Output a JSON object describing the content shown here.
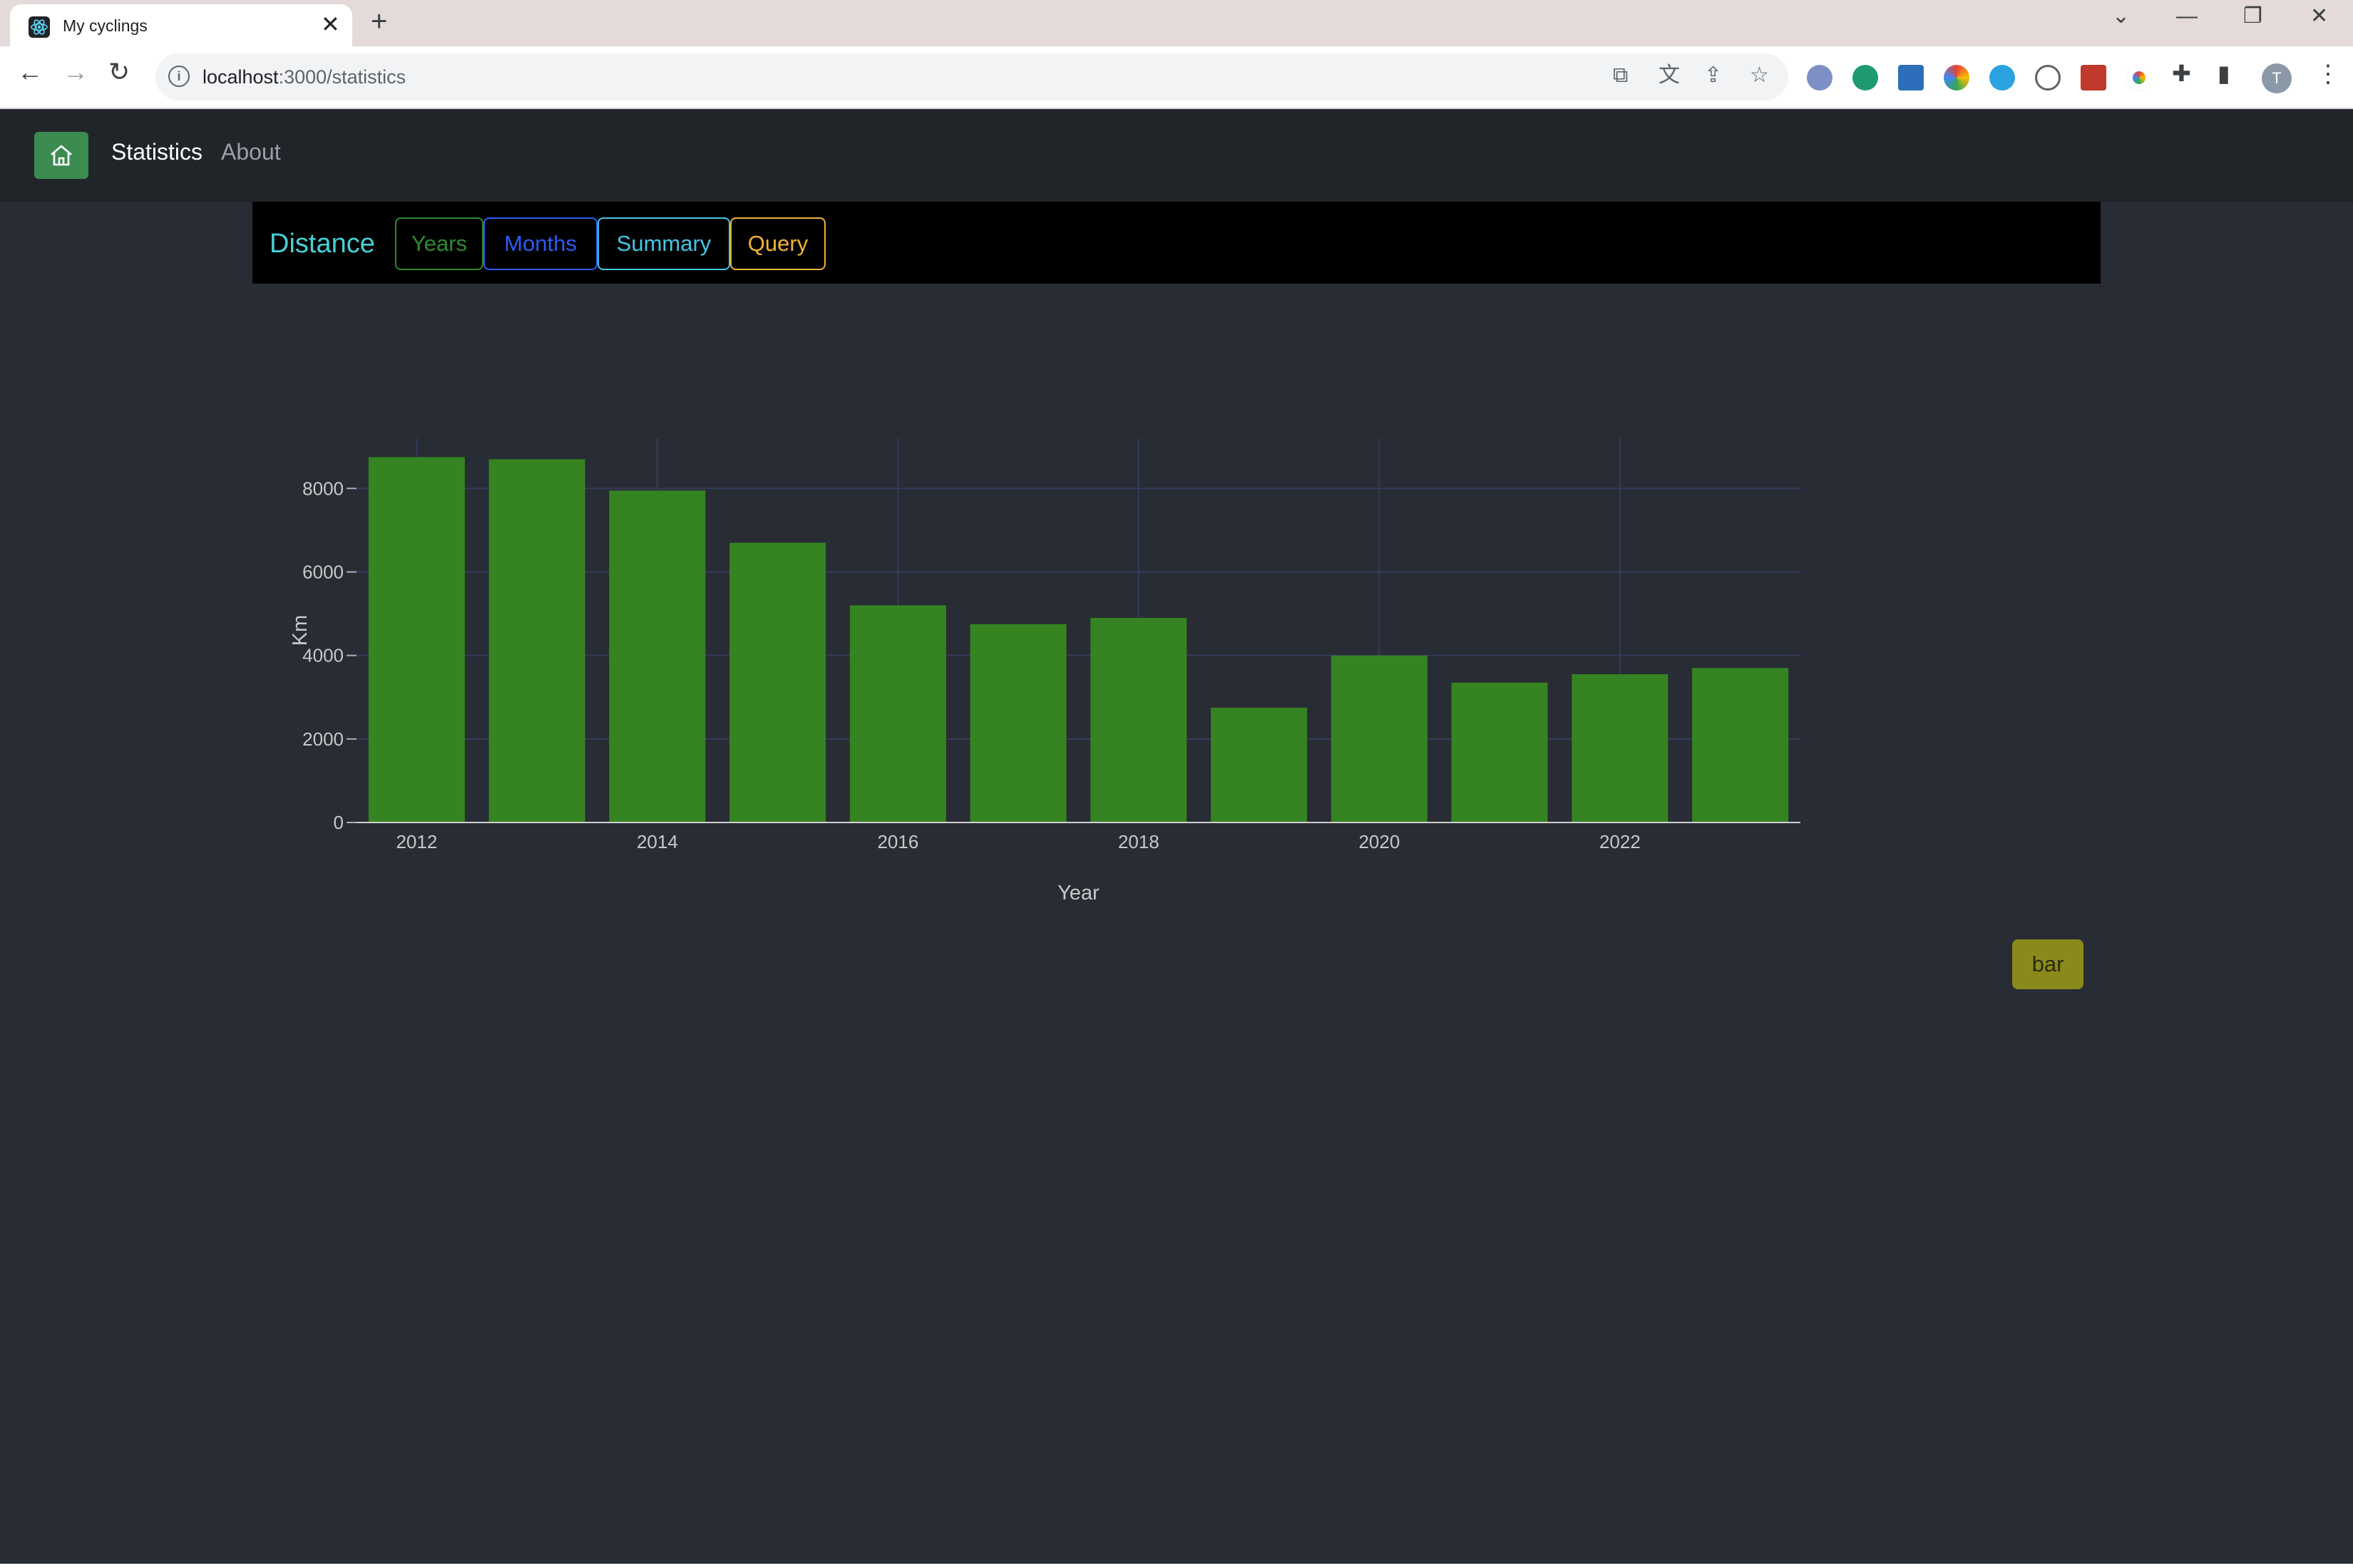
{
  "browser": {
    "tab_title": "My cyclings",
    "url_host": "localhost",
    "url_path": ":3000/statistics",
    "avatar_initial": "T",
    "icons": {
      "favicon": "react-logo-icon",
      "close": "close-icon",
      "new_tab": "plus-icon",
      "back": "arrow-left-icon",
      "forward": "arrow-right-icon",
      "reload": "reload-icon",
      "info": "info-icon",
      "star": "star-icon",
      "menu": "kebab-menu-icon"
    },
    "glyphs": {
      "close": "✕",
      "new_tab": "+",
      "back": "←",
      "forward": "→",
      "reload": "↻",
      "info": "i",
      "open": "⧉",
      "translate": "文",
      "share": "⇪",
      "star": "☆",
      "puzzle": "✚",
      "sidepanel": "▮",
      "menu": "⋮",
      "chevron": "⌄",
      "minimize": "—",
      "restore": "❐",
      "win_close": "✕"
    }
  },
  "navbar": {
    "home_icon": "home-icon",
    "links": [
      {
        "label": "Statistics",
        "active": true
      },
      {
        "label": "About",
        "active": false
      }
    ]
  },
  "subbar": {
    "brand": "Distance",
    "buttons": [
      {
        "label": "Years",
        "color": "#2e8b2e"
      },
      {
        "label": "Months",
        "color": "#2c5cf3"
      },
      {
        "label": "Summary",
        "color": "#44c7e8"
      },
      {
        "label": "Query",
        "color": "#f0b43a"
      }
    ]
  },
  "chart_type_button": {
    "label": "bar",
    "color": "#8a8a1c"
  },
  "chart_data": {
    "type": "bar",
    "categories": [
      "2012",
      "2013",
      "2014",
      "2015",
      "2016",
      "2017",
      "2018",
      "2019",
      "2020",
      "2021",
      "2022",
      "2023"
    ],
    "values": [
      8750,
      8700,
      7950,
      6700,
      5200,
      4750,
      4900,
      2750,
      4000,
      3350,
      3550,
      3700
    ],
    "xlabel": "Year",
    "ylabel": "Km",
    "x_tick_labels": [
      "2012",
      "2014",
      "2016",
      "2018",
      "2020",
      "2022"
    ],
    "y_tick_labels": [
      "0",
      "2000",
      "4000",
      "6000",
      "8000"
    ],
    "ylim": [
      0,
      9200
    ],
    "grid": true,
    "bar_color": "#368321",
    "background": "#282c34"
  }
}
